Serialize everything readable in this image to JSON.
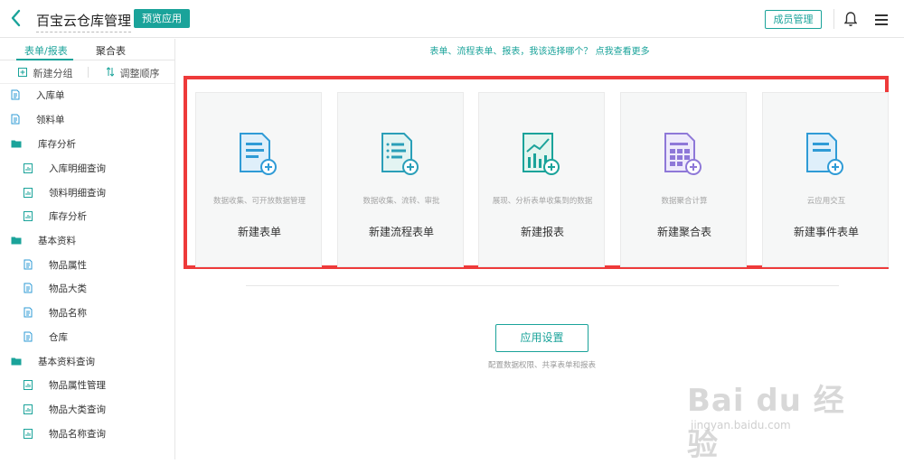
{
  "header": {
    "app_title": "百宝云仓库管理",
    "preview_label": "预览应用",
    "member_label": "成员管理"
  },
  "sidebar": {
    "tabs": [
      {
        "label": "表单/报表",
        "active": true
      },
      {
        "label": "聚合表",
        "active": false
      }
    ],
    "actions": {
      "new_group": "新建分组",
      "reorder": "调整顺序"
    },
    "items": [
      {
        "label": "入库单",
        "type": "form"
      },
      {
        "label": "领料单",
        "type": "form"
      },
      {
        "label": "库存分析",
        "type": "folder"
      },
      {
        "label": "入库明细查询",
        "type": "report"
      },
      {
        "label": "领料明细查询",
        "type": "report"
      },
      {
        "label": "库存分析",
        "type": "report"
      },
      {
        "label": "基本资料",
        "type": "folder"
      },
      {
        "label": "物品属性",
        "type": "form"
      },
      {
        "label": "物品大类",
        "type": "form"
      },
      {
        "label": "物品名称",
        "type": "form"
      },
      {
        "label": "仓库",
        "type": "form"
      },
      {
        "label": "基本资料查询",
        "type": "folder"
      },
      {
        "label": "物品属性管理",
        "type": "report"
      },
      {
        "label": "物品大类查询",
        "type": "report"
      },
      {
        "label": "物品名称查询",
        "type": "report"
      }
    ]
  },
  "main": {
    "hint": "表单、流程表单、报表，我该选择哪个？ 点我查看更多",
    "cards": [
      {
        "desc": "数据收集、可开放数据管理",
        "title": "新建表单",
        "icon": "form-icon"
      },
      {
        "desc": "数据收集、流转、审批",
        "title": "新建流程表单",
        "icon": "flow-form-icon"
      },
      {
        "desc": "展现、分析表单收集到的数据",
        "title": "新建报表",
        "icon": "report-icon"
      },
      {
        "desc": "数据聚合计算",
        "title": "新建聚合表",
        "icon": "aggregate-icon"
      },
      {
        "desc": "云应用交互",
        "title": "新建事件表单",
        "icon": "event-form-icon"
      }
    ],
    "settings_label": "应用设置",
    "settings_desc": "配置数据权限、共享表单和报表"
  },
  "watermark": {
    "main": "Bai du 经验",
    "sub": "jingyan.baidu.com"
  },
  "colors": {
    "accent": "#1aa39a",
    "highlight": "#ee3a3a",
    "form_icon": "#2f9bd6",
    "aggregate_icon": "#8e78d8"
  }
}
